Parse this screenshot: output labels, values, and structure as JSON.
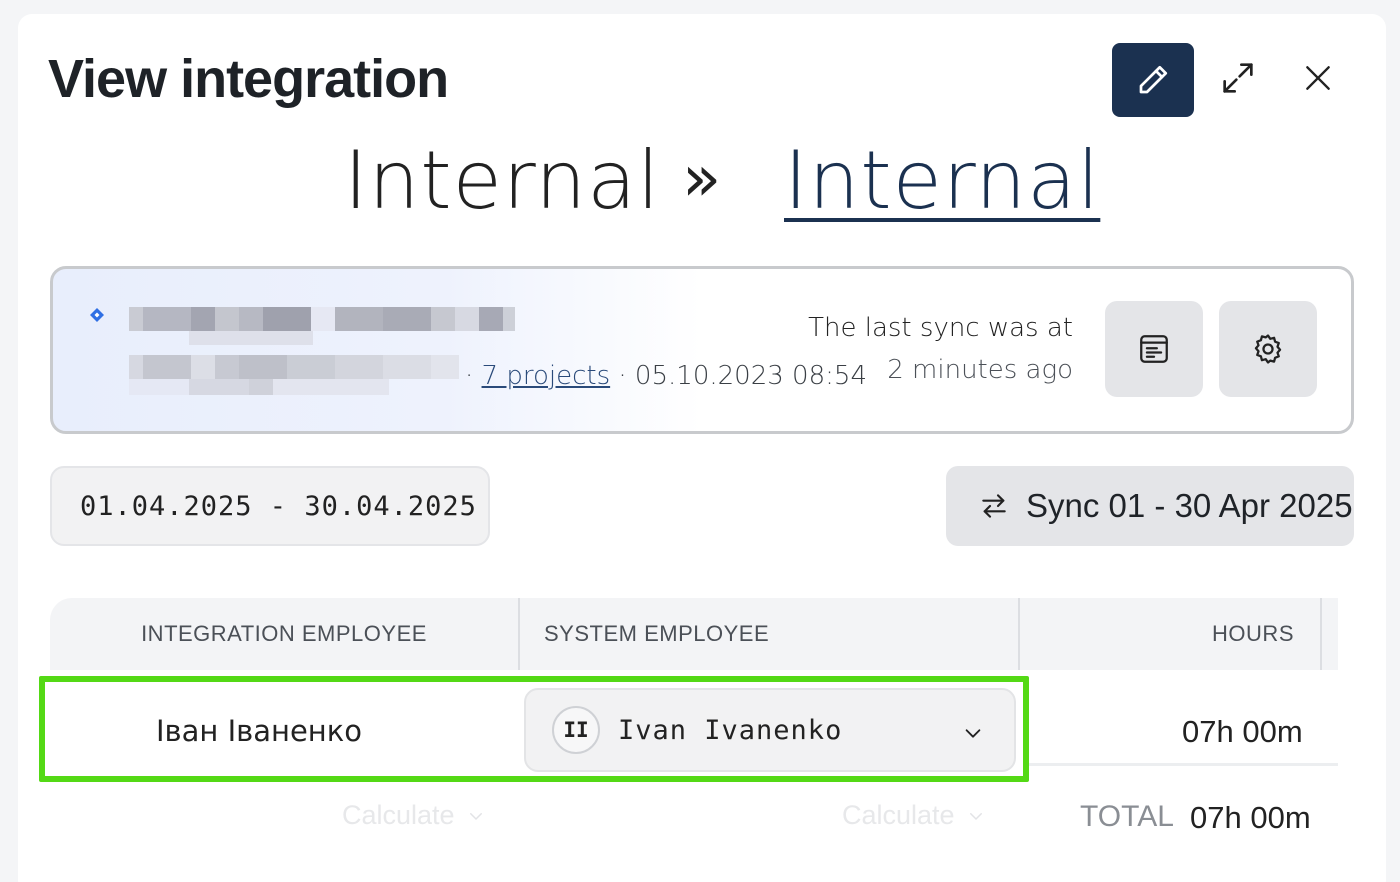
{
  "header": {
    "title": "View integration"
  },
  "route": {
    "source": "Internal",
    "separator": "»",
    "destination": "Internal"
  },
  "integration_card": {
    "projects_link": "7 projects",
    "created_at": "05.10.2023 08:54",
    "separator": "·",
    "last_sync_label": "The last sync was at",
    "last_sync_value": "2 minutes ago"
  },
  "filters": {
    "date_range": "01.04.2025 - 30.04.2025",
    "sync_button_label": "Sync 01 - 30 Apr 2025"
  },
  "table": {
    "columns": [
      "INTEGRATION EMPLOYEE",
      "SYSTEM EMPLOYEE",
      "HOURS"
    ],
    "rows": [
      {
        "integration_employee": "Іван Іваненко",
        "system_employee_initials": "II",
        "system_employee": "Ivan Ivanenko",
        "hours": "07h 00m"
      }
    ],
    "footer": {
      "calculate_label_1": "Calculate",
      "calculate_label_2": "Calculate",
      "total_label": "TOTAL",
      "total_value": "07h 00m"
    }
  },
  "colors": {
    "accent": "#1b3150",
    "highlight": "#54d915",
    "jira_blue": "#2f6fe4"
  }
}
